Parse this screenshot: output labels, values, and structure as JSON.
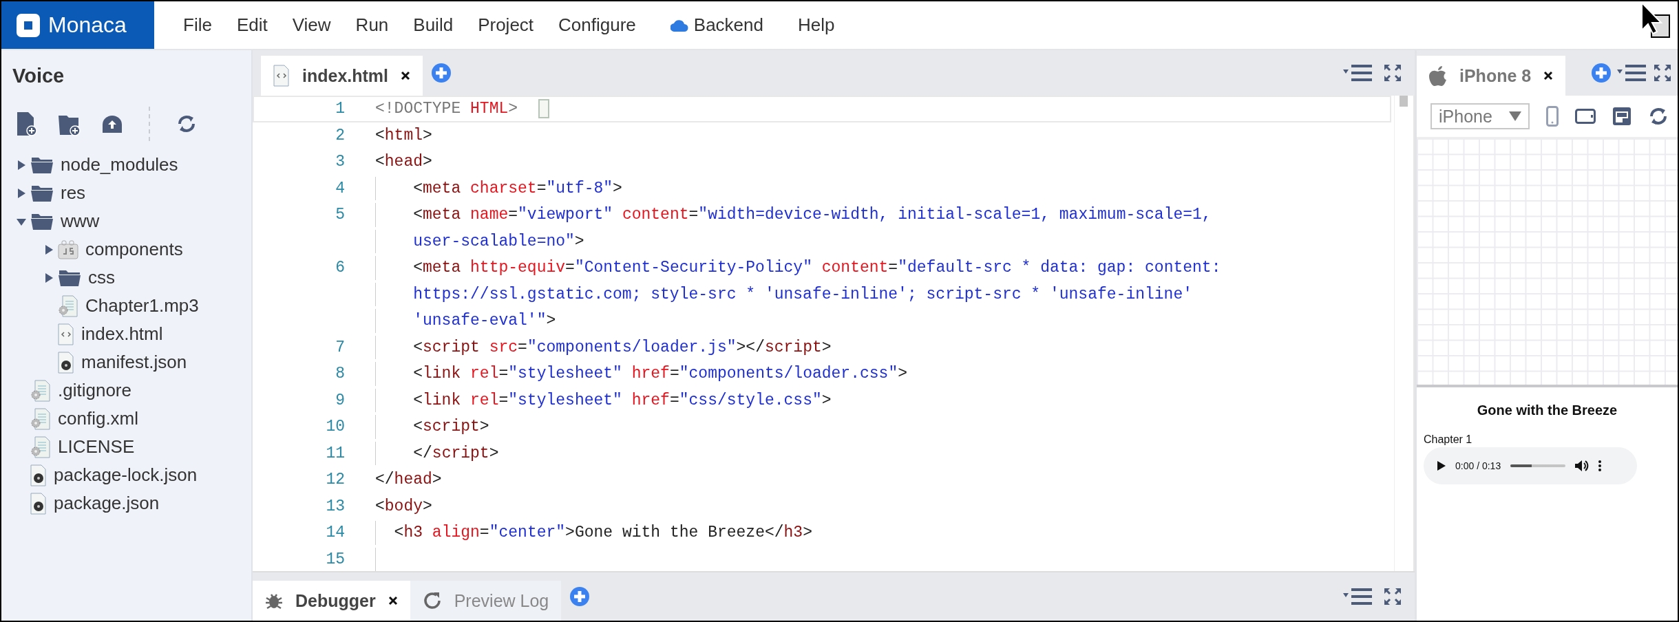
{
  "logo": "Monaca",
  "menu": [
    {
      "label": "File",
      "kind": "plain"
    },
    {
      "label": "Edit",
      "kind": "plain"
    },
    {
      "label": "View",
      "kind": "plain"
    },
    {
      "label": "Run",
      "kind": "plain"
    },
    {
      "label": "Build",
      "kind": "plain"
    },
    {
      "label": "Project",
      "kind": "plain"
    },
    {
      "label": "Configure",
      "kind": "plain"
    },
    {
      "label": "Backend",
      "kind": "cloud"
    },
    {
      "label": "Help",
      "kind": "plain"
    }
  ],
  "sidebar": {
    "title": "Voice",
    "tree": [
      {
        "label": "node_modules",
        "kind": "folder",
        "expanded": false
      },
      {
        "label": "res",
        "kind": "folder",
        "expanded": false
      },
      {
        "label": "www",
        "kind": "folder",
        "expanded": true,
        "children": [
          {
            "label": "components",
            "kind": "script-folder",
            "expanded": false
          },
          {
            "label": "css",
            "kind": "folder",
            "expanded": false
          },
          {
            "label": "Chapter1.mp3",
            "kind": "gear-file"
          },
          {
            "label": "index.html",
            "kind": "code-file"
          },
          {
            "label": "manifest.json",
            "kind": "disc-file"
          }
        ]
      },
      {
        "label": ".gitignore",
        "kind": "gear-file"
      },
      {
        "label": "config.xml",
        "kind": "gear-file"
      },
      {
        "label": "LICENSE",
        "kind": "gear-file"
      },
      {
        "label": "package-lock.json",
        "kind": "disc-file"
      },
      {
        "label": "package.json",
        "kind": "disc-file"
      }
    ]
  },
  "editor": {
    "tabs": [
      {
        "label": "index.html",
        "selected": true
      }
    ],
    "lines": [
      {
        "number": "1",
        "current": true,
        "rows": [
          {
            "segments": [
              {
                "kind": "doctype",
                "text": "<!DOCTYPE "
              },
              {
                "kind": "attr",
                "text": "HTML"
              },
              {
                "kind": "doctype",
                "text": ">"
              }
            ]
          }
        ]
      },
      {
        "number": "2",
        "current": false,
        "rows": [
          {
            "segments": [
              {
                "kind": "punct",
                "text": "<"
              },
              {
                "kind": "tag",
                "text": "html"
              },
              {
                "kind": "punct",
                "text": ">"
              }
            ]
          }
        ]
      },
      {
        "number": "3",
        "current": false,
        "rows": [
          {
            "segments": [
              {
                "kind": "punct",
                "text": "<"
              },
              {
                "kind": "tag",
                "text": "head"
              },
              {
                "kind": "punct",
                "text": ">"
              }
            ]
          }
        ]
      },
      {
        "number": "4",
        "current": false,
        "rows": [
          {
            "segments": [
              {
                "kind": "punct",
                "text": "    <"
              },
              {
                "kind": "tag",
                "text": "meta"
              },
              {
                "kind": "attr",
                "text": " charset"
              },
              {
                "kind": "punct",
                "text": "="
              },
              {
                "kind": "value",
                "text": "\"utf-8\""
              },
              {
                "kind": "punct",
                "text": ">"
              }
            ]
          }
        ]
      },
      {
        "number": "5",
        "current": false,
        "rows": [
          {
            "segments": [
              {
                "kind": "punct",
                "text": "    <"
              },
              {
                "kind": "tag",
                "text": "meta"
              },
              {
                "kind": "attr",
                "text": " name"
              },
              {
                "kind": "punct",
                "text": "="
              },
              {
                "kind": "value",
                "text": "\"viewport\""
              },
              {
                "kind": "attr",
                "text": " content"
              },
              {
                "kind": "punct",
                "text": "="
              },
              {
                "kind": "value",
                "text": "\"width=device-width, initial-scale=1, maximum-scale=1,"
              }
            ]
          },
          {
            "segments": [
              {
                "kind": "value",
                "text": "    user-scalable=no\""
              },
              {
                "kind": "punct",
                "text": ">"
              }
            ]
          }
        ]
      },
      {
        "number": "6",
        "current": false,
        "rows": [
          {
            "segments": [
              {
                "kind": "punct",
                "text": "    <"
              },
              {
                "kind": "tag",
                "text": "meta"
              },
              {
                "kind": "attr",
                "text": " http-equiv"
              },
              {
                "kind": "punct",
                "text": "="
              },
              {
                "kind": "value",
                "text": "\"Content-Security-Policy\""
              },
              {
                "kind": "attr",
                "text": " content"
              },
              {
                "kind": "punct",
                "text": "="
              },
              {
                "kind": "value",
                "text": "\"default-src * data: gap: content:"
              }
            ]
          },
          {
            "segments": [
              {
                "kind": "value",
                "text": "    https://ssl.gstatic.com; style-src * 'unsafe-inline'; script-src * 'unsafe-inline'"
              }
            ]
          },
          {
            "segments": [
              {
                "kind": "value",
                "text": "    'unsafe-eval'\""
              },
              {
                "kind": "punct",
                "text": ">"
              }
            ]
          }
        ]
      },
      {
        "number": "7",
        "current": false,
        "rows": [
          {
            "segments": [
              {
                "kind": "punct",
                "text": "    <"
              },
              {
                "kind": "tag",
                "text": "script"
              },
              {
                "kind": "attr",
                "text": " src"
              },
              {
                "kind": "punct",
                "text": "="
              },
              {
                "kind": "value",
                "text": "\"components/loader.js\""
              },
              {
                "kind": "punct",
                "text": "></"
              },
              {
                "kind": "tag",
                "text": "script"
              },
              {
                "kind": "punct",
                "text": ">"
              }
            ]
          }
        ]
      },
      {
        "number": "8",
        "current": false,
        "rows": [
          {
            "segments": [
              {
                "kind": "punct",
                "text": "    <"
              },
              {
                "kind": "tag",
                "text": "link"
              },
              {
                "kind": "attr",
                "text": " rel"
              },
              {
                "kind": "punct",
                "text": "="
              },
              {
                "kind": "value",
                "text": "\"stylesheet\""
              },
              {
                "kind": "attr",
                "text": " href"
              },
              {
                "kind": "punct",
                "text": "="
              },
              {
                "kind": "value",
                "text": "\"components/loader.css\""
              },
              {
                "kind": "punct",
                "text": ">"
              }
            ]
          }
        ]
      },
      {
        "number": "9",
        "current": false,
        "rows": [
          {
            "segments": [
              {
                "kind": "punct",
                "text": "    <"
              },
              {
                "kind": "tag",
                "text": "link"
              },
              {
                "kind": "attr",
                "text": " rel"
              },
              {
                "kind": "punct",
                "text": "="
              },
              {
                "kind": "value",
                "text": "\"stylesheet\""
              },
              {
                "kind": "attr",
                "text": " href"
              },
              {
                "kind": "punct",
                "text": "="
              },
              {
                "kind": "value",
                "text": "\"css/style.css\""
              },
              {
                "kind": "punct",
                "text": ">"
              }
            ]
          }
        ]
      },
      {
        "number": "10",
        "current": false,
        "rows": [
          {
            "segments": [
              {
                "kind": "punct",
                "text": "    <"
              },
              {
                "kind": "tag",
                "text": "script"
              },
              {
                "kind": "punct",
                "text": ">"
              }
            ]
          }
        ]
      },
      {
        "number": "11",
        "current": false,
        "rows": [
          {
            "segments": [
              {
                "kind": "punct",
                "text": "    </"
              },
              {
                "kind": "tag",
                "text": "script"
              },
              {
                "kind": "punct",
                "text": ">"
              }
            ]
          }
        ]
      },
      {
        "number": "12",
        "current": false,
        "rows": [
          {
            "segments": [
              {
                "kind": "punct",
                "text": "</"
              },
              {
                "kind": "tag",
                "text": "head"
              },
              {
                "kind": "punct",
                "text": ">"
              }
            ]
          }
        ]
      },
      {
        "number": "13",
        "current": false,
        "rows": [
          {
            "segments": [
              {
                "kind": "punct",
                "text": "<"
              },
              {
                "kind": "tag",
                "text": "body"
              },
              {
                "kind": "punct",
                "text": ">"
              }
            ]
          }
        ]
      },
      {
        "number": "14",
        "current": false,
        "rows": [
          {
            "segments": [
              {
                "kind": "punct",
                "text": "  <"
              },
              {
                "kind": "tag",
                "text": "h3"
              },
              {
                "kind": "attr",
                "text": " align"
              },
              {
                "kind": "punct",
                "text": "="
              },
              {
                "kind": "value",
                "text": "\"center\""
              },
              {
                "kind": "punct",
                "text": ">Gone with the Breeze</"
              },
              {
                "kind": "tag",
                "text": "h3"
              },
              {
                "kind": "punct",
                "text": ">"
              }
            ]
          }
        ]
      },
      {
        "number": "15",
        "current": false,
        "rows": [
          {
            "segments": []
          }
        ]
      }
    ]
  },
  "bottom_panel": {
    "tabs": [
      {
        "label": "Debugger",
        "kind": "bug",
        "selected": true
      },
      {
        "label": "Preview Log",
        "kind": "refresh",
        "selected": false
      }
    ]
  },
  "preview": {
    "tabs": [
      {
        "label": "iPhone 8",
        "selected": true
      }
    ],
    "device_select": "iPhone",
    "page": {
      "heading": "Gone with the Breeze",
      "caption": "Chapter 1",
      "audio": {
        "time": "0:00 / 0:13",
        "level": 0.38
      }
    }
  }
}
